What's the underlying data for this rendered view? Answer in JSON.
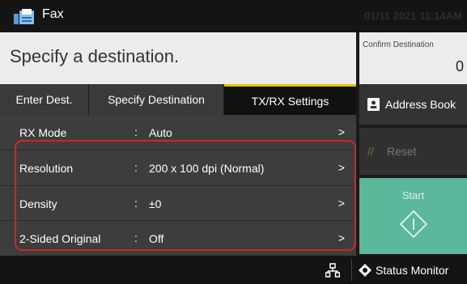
{
  "header": {
    "title": "Fax",
    "datetime": "01/11 2021 11:14AM",
    "app_icon": "fax-icon"
  },
  "destination": {
    "prompt": "Specify a destination.",
    "confirm_label": "Confirm Destination",
    "confirm_value": "0"
  },
  "tabs": [
    {
      "label": "Enter Dest."
    },
    {
      "label": "Specify Destination"
    },
    {
      "label": "TX/RX Settings",
      "active": true
    }
  ],
  "settings": [
    {
      "label": "RX Mode",
      "value": "Auto"
    },
    {
      "label": "Resolution",
      "value": "200 x 100 dpi (Normal)"
    },
    {
      "label": "Density",
      "value": "±0"
    },
    {
      "label": "2-Sided Original",
      "value": "Off"
    }
  ],
  "sidebar": {
    "address_book": "Address Book",
    "reset": "Reset",
    "start": "Start"
  },
  "footer": {
    "status_monitor": "Status Monitor",
    "network_icon": "network-icon"
  },
  "colors": {
    "active_tab_accent": "#e5c400",
    "highlight": "#d42424",
    "start_button": "#5bb89a"
  }
}
